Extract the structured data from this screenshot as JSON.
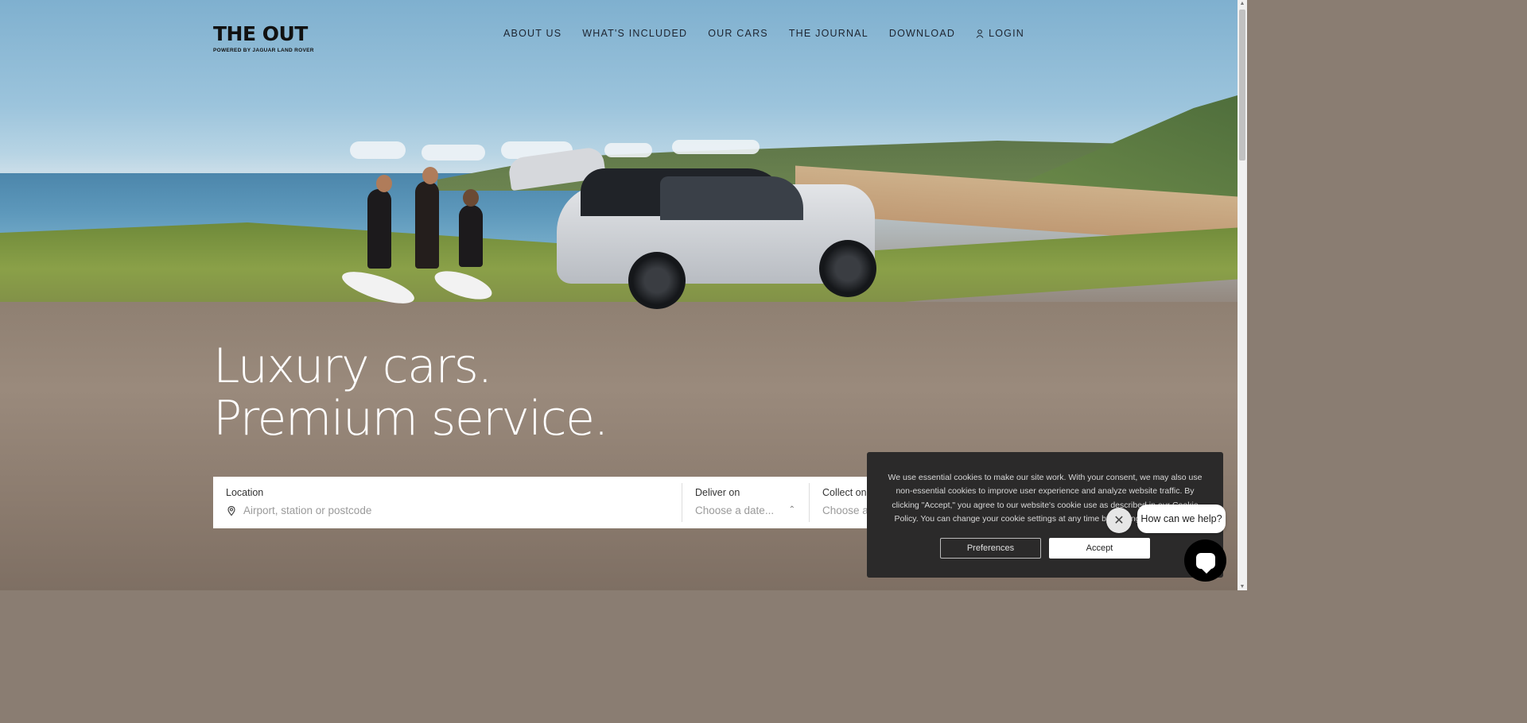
{
  "logo": {
    "name": "THE OUT",
    "tagline": "POWERED BY JAGUAR LAND ROVER"
  },
  "nav": {
    "items": [
      {
        "label": "ABOUT US"
      },
      {
        "label": "WHAT'S INCLUDED"
      },
      {
        "label": "OUR CARS"
      },
      {
        "label": "THE JOURNAL"
      },
      {
        "label": "DOWNLOAD"
      }
    ],
    "login_label": "LOGIN"
  },
  "hero": {
    "line1": "Luxury cars.",
    "line2": "Premium service."
  },
  "search": {
    "location_label": "Location",
    "location_placeholder": "Airport, station or postcode",
    "deliver_label": "Deliver on",
    "deliver_placeholder": "Choose a date...",
    "collect_label": "Collect on",
    "collect_placeholder": "Choose a date..."
  },
  "cookie": {
    "text": "We use essential cookies to make our site work. With your consent, we may also use non-essential cookies to improve user experience and analyze website traffic. By clicking \"Accept,\" you agree to our website's cookie use as described in our Cookie Policy. You can change your cookie settings at any time by clicking \"Preferences.\"",
    "preferences_label": "Preferences",
    "accept_label": "Accept"
  },
  "chat": {
    "prompt": "How can we help?",
    "close_glyph": "✕"
  },
  "icons": {
    "user": "user-icon",
    "pin": "location-pin-icon",
    "updown": "chevron-updown-icon",
    "chat": "chat-bubble-icon"
  },
  "colors": {
    "nav_text": "#1d2430",
    "cookie_bg": "#2b2a2a",
    "chat_button": "#000000"
  }
}
